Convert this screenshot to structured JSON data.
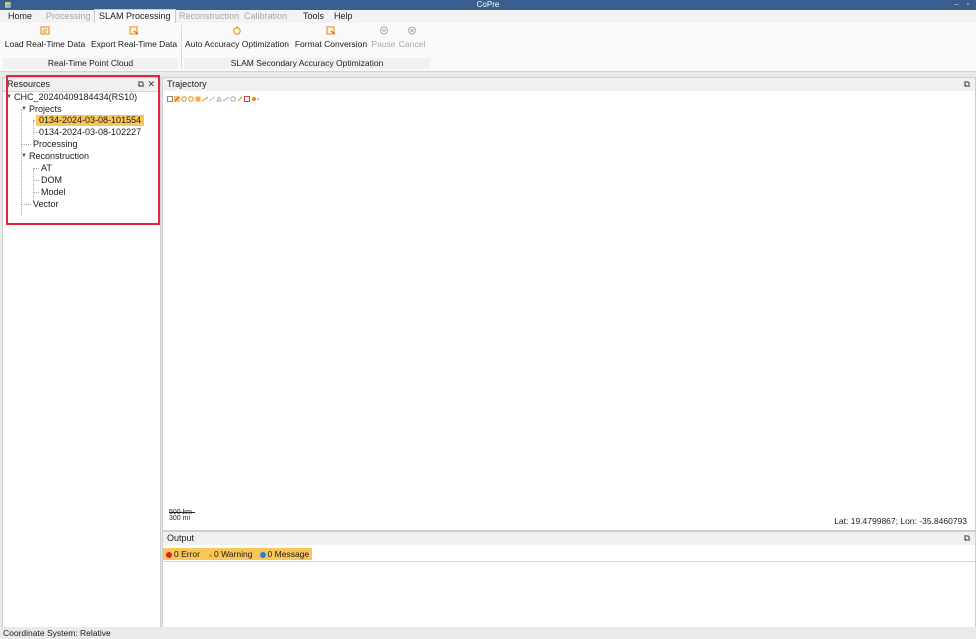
{
  "window": {
    "title": "CoPre"
  },
  "menu": [
    {
      "label": "Home",
      "enabled": true
    },
    {
      "label": "Processing",
      "enabled": false
    },
    {
      "label": "SLAM Processing",
      "enabled": true,
      "active": true
    },
    {
      "label": "Reconstruction",
      "enabled": false
    },
    {
      "label": "Calibration",
      "enabled": false
    },
    {
      "label": "Tools",
      "enabled": true
    },
    {
      "label": "Help",
      "enabled": true
    }
  ],
  "ribbon": {
    "buttons": [
      {
        "label": "Load Real-Time Data",
        "icon": "load-data-icon",
        "enabled": true
      },
      {
        "label": "Export Real-Time Data",
        "icon": "export-data-icon",
        "enabled": true
      },
      {
        "label": "Auto Accuracy Optimization",
        "icon": "auto-optimize-icon",
        "enabled": true
      },
      {
        "label": "Format Conversion",
        "icon": "format-convert-icon",
        "enabled": true
      },
      {
        "label": "Pause",
        "icon": "pause-icon",
        "enabled": false
      },
      {
        "label": "Cancel",
        "icon": "cancel-icon",
        "enabled": false
      }
    ],
    "groups": [
      {
        "label": "Real-Time Point Cloud"
      },
      {
        "label": "SLAM Secondary Accuracy Optimization"
      }
    ]
  },
  "resources": {
    "title": "Resources",
    "tree": {
      "root": "CHC_20240409184434(RS10)",
      "projects_label": "Projects",
      "projects": [
        "0134-2024-03-08-101554",
        "0134-2024-03-08-102227"
      ],
      "selected_project": "0134-2024-03-08-101554",
      "processing_label": "Processing",
      "reconstruction_label": "Reconstruction",
      "reconstruction_children": [
        "AT",
        "DOM",
        "Model"
      ],
      "vector_label": "Vector"
    }
  },
  "trajectory": {
    "title": "Trajectory",
    "scale_top": "500 km",
    "scale_bottom": "300 mi",
    "coords": "Lat: 19.4799867; Lon: -35.8460793"
  },
  "output": {
    "title": "Output",
    "error": "0 Error",
    "warning": "0 Warning",
    "message": "0 Message"
  },
  "status": {
    "coord_system": "Coordinate System: Relative"
  },
  "colors": {
    "accent": "#f9c65a",
    "highlight_border": "#e0273b",
    "titlebar": "#3a5f8f"
  }
}
